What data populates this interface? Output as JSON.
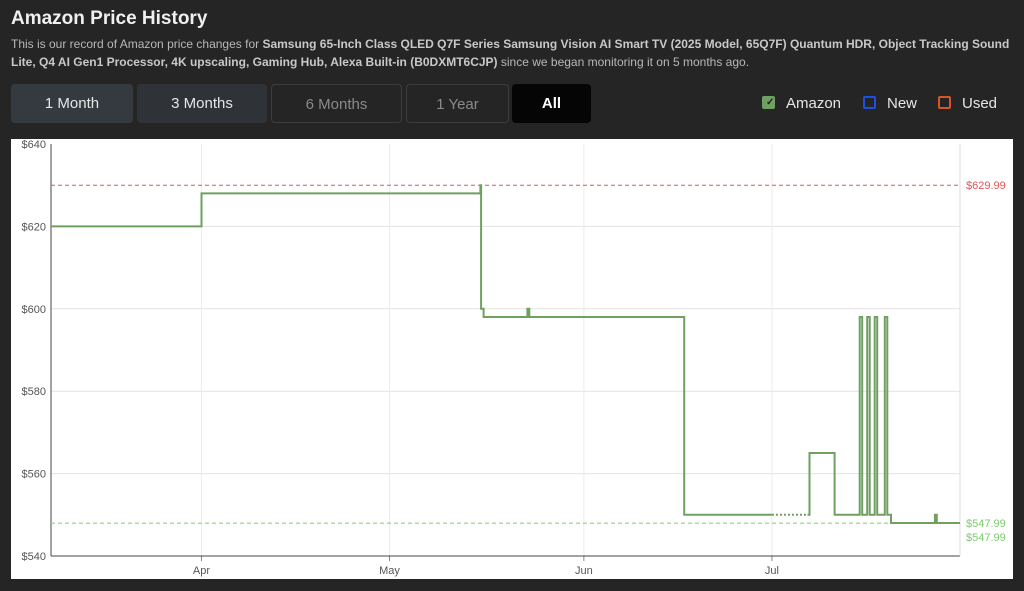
{
  "header": {
    "title": "Amazon Price History",
    "desc_prefix": "This is our record of Amazon price changes for ",
    "product": "Samsung 65-Inch Class QLED Q7F Series Samsung Vision AI Smart TV (2025 Model, 65Q7F) Quantum HDR, Object Tracking Sound Lite, Q4 AI Gen1 Processor, 4K upscaling, Gaming Hub, Alexa Built-in (B0DXMT6CJP)",
    "desc_suffix": " since we began monitoring it on 5 months ago."
  },
  "tabs": [
    {
      "label": "1 Month"
    },
    {
      "label": "3 Months"
    },
    {
      "label": "6 Months"
    },
    {
      "label": "1 Year"
    },
    {
      "label": "All",
      "selected": true
    }
  ],
  "legend": {
    "amazon": {
      "label": "Amazon",
      "color": "#6fa062",
      "checked": true
    },
    "new": {
      "label": "New",
      "color": "#1f4fe0",
      "checked": false
    },
    "used": {
      "label": "Used",
      "color": "#d9532b",
      "checked": false
    }
  },
  "chart_data": {
    "type": "line",
    "y_ticks": [
      "$640",
      "$620",
      "$600",
      "$580",
      "$560",
      "$540"
    ],
    "ylim": [
      540,
      640
    ],
    "x_ticks": [
      {
        "label": "Apr",
        "day": 20
      },
      {
        "label": "May",
        "day": 50
      },
      {
        "label": "Jun",
        "day": 81
      },
      {
        "label": "Jul",
        "day": 111
      }
    ],
    "xlim": [
      -4,
      141
    ],
    "reference_lines": [
      {
        "label": "$629.99",
        "value": 629.99,
        "color": "#e05555"
      },
      {
        "label": "$547.99",
        "value": 547.99,
        "color": "#7ccb6e"
      }
    ],
    "current_label": "$547.99",
    "series": [
      {
        "color": "#6fa062",
        "points": [
          [
            -4,
            620
          ],
          [
            20,
            620
          ],
          [
            20,
            628
          ],
          [
            64.5,
            628
          ],
          [
            64.5,
            630
          ],
          [
            64.6,
            630
          ],
          [
            64.6,
            600
          ],
          [
            65,
            600
          ],
          [
            65,
            598
          ],
          [
            72,
            598
          ],
          [
            72,
            600
          ],
          [
            72.3,
            600
          ],
          [
            72.3,
            598
          ],
          [
            97,
            598
          ],
          [
            97,
            550
          ],
          [
            117,
            550
          ],
          [
            117,
            565
          ],
          [
            121,
            565
          ],
          [
            121,
            550
          ],
          [
            125,
            550
          ],
          [
            125,
            598
          ],
          [
            125.4,
            598
          ],
          [
            125.4,
            550
          ],
          [
            126.2,
            550
          ],
          [
            126.2,
            598
          ],
          [
            126.6,
            598
          ],
          [
            126.6,
            550
          ],
          [
            127.4,
            550
          ],
          [
            127.4,
            598
          ],
          [
            127.8,
            598
          ],
          [
            127.8,
            550
          ],
          [
            129,
            550
          ],
          [
            129,
            598
          ],
          [
            129.4,
            598
          ],
          [
            129.4,
            550
          ],
          [
            130,
            550
          ],
          [
            130,
            548
          ],
          [
            137,
            548
          ],
          [
            137,
            550
          ],
          [
            137.3,
            550
          ],
          [
            137.3,
            548
          ],
          [
            141,
            548
          ]
        ],
        "dotted_range": [
          111,
          117
        ]
      }
    ]
  }
}
